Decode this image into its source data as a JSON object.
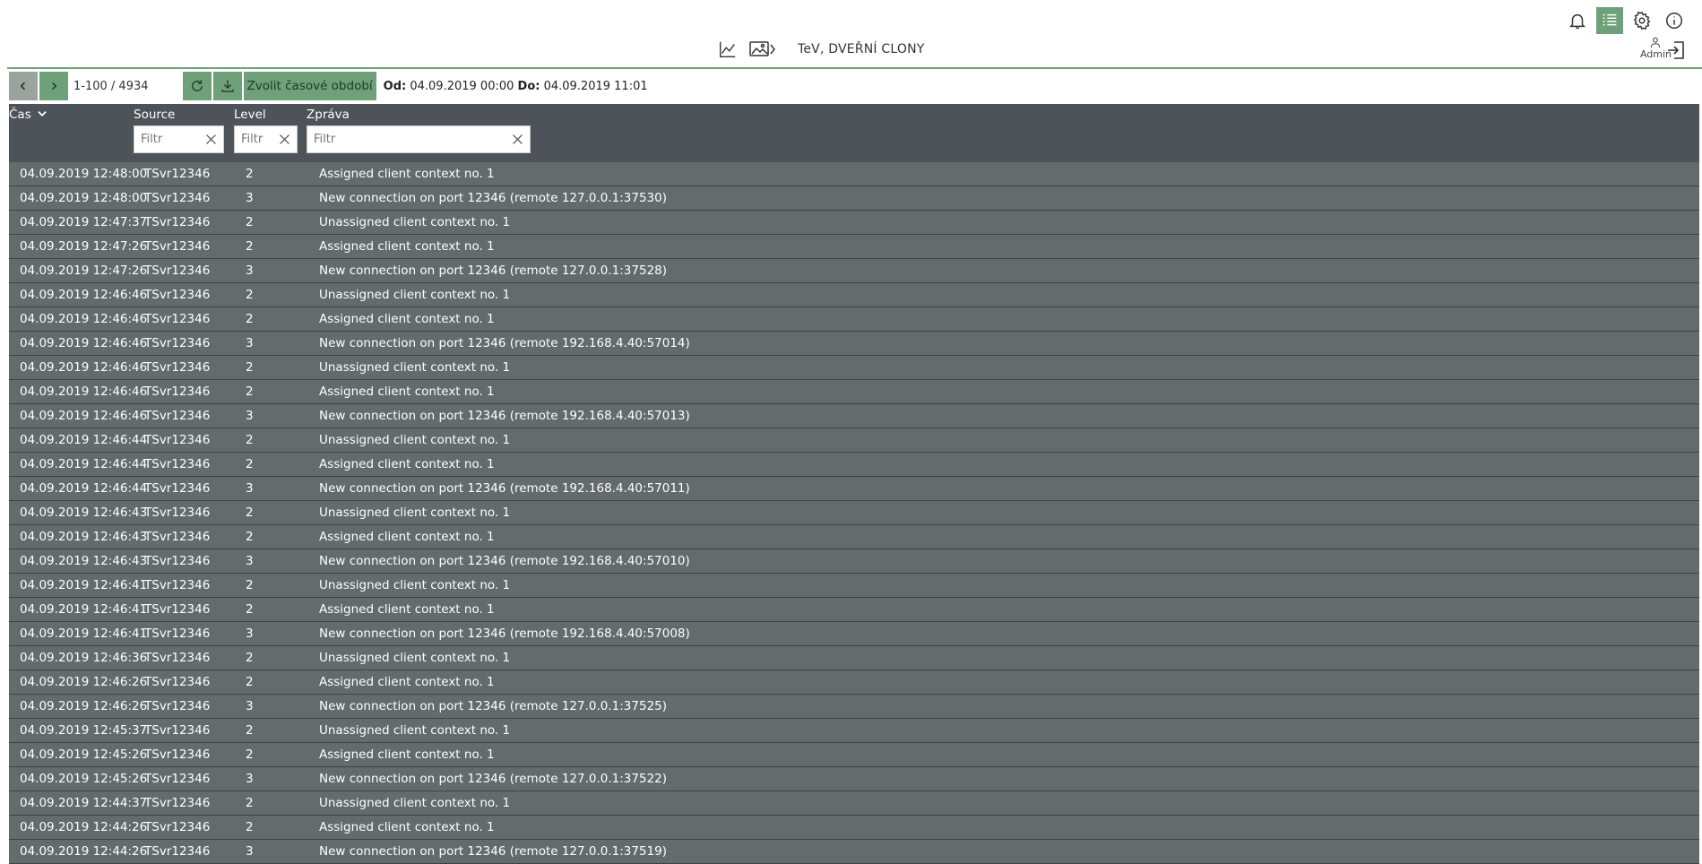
{
  "header": {
    "title": "TeV, DVEŘNÍ CLONY",
    "user": "Admin",
    "colors": {
      "accent": "#6ea07a",
      "table_header": "#4d5358",
      "row": "#636b6d"
    }
  },
  "toolbar": {
    "range": "1-100 / 4934",
    "choose_period_label": "Zvolit časové období",
    "from_label": "Od:",
    "from_value": "04.09.2019 00:00",
    "to_label": "Do:",
    "to_value": "04.09.2019 11:01"
  },
  "table": {
    "columns": {
      "time": "Čas",
      "source": "Source",
      "level": "Level",
      "message": "Zpráva"
    },
    "filter_placeholder": "Filtr",
    "rows": [
      {
        "time": "04.09.2019 12:48:00",
        "source": "TSvr12346",
        "level": "2",
        "message": "Assigned client context no. 1"
      },
      {
        "time": "04.09.2019 12:48:00",
        "source": "TSvr12346",
        "level": "3",
        "message": "New connection on port 12346 (remote 127.0.0.1:37530)"
      },
      {
        "time": "04.09.2019 12:47:37",
        "source": "TSvr12346",
        "level": "2",
        "message": "Unassigned client context no. 1"
      },
      {
        "time": "04.09.2019 12:47:26",
        "source": "TSvr12346",
        "level": "2",
        "message": "Assigned client context no. 1"
      },
      {
        "time": "04.09.2019 12:47:26",
        "source": "TSvr12346",
        "level": "3",
        "message": "New connection on port 12346 (remote 127.0.0.1:37528)"
      },
      {
        "time": "04.09.2019 12:46:46",
        "source": "TSvr12346",
        "level": "2",
        "message": "Unassigned client context no. 1"
      },
      {
        "time": "04.09.2019 12:46:46",
        "source": "TSvr12346",
        "level": "2",
        "message": "Assigned client context no. 1"
      },
      {
        "time": "04.09.2019 12:46:46",
        "source": "TSvr12346",
        "level": "3",
        "message": "New connection on port 12346 (remote 192.168.4.40:57014)"
      },
      {
        "time": "04.09.2019 12:46:46",
        "source": "TSvr12346",
        "level": "2",
        "message": "Unassigned client context no. 1"
      },
      {
        "time": "04.09.2019 12:46:46",
        "source": "TSvr12346",
        "level": "2",
        "message": "Assigned client context no. 1"
      },
      {
        "time": "04.09.2019 12:46:46",
        "source": "TSvr12346",
        "level": "3",
        "message": "New connection on port 12346 (remote 192.168.4.40:57013)"
      },
      {
        "time": "04.09.2019 12:46:44",
        "source": "TSvr12346",
        "level": "2",
        "message": "Unassigned client context no. 1"
      },
      {
        "time": "04.09.2019 12:46:44",
        "source": "TSvr12346",
        "level": "2",
        "message": "Assigned client context no. 1"
      },
      {
        "time": "04.09.2019 12:46:44",
        "source": "TSvr12346",
        "level": "3",
        "message": "New connection on port 12346 (remote 192.168.4.40:57011)"
      },
      {
        "time": "04.09.2019 12:46:43",
        "source": "TSvr12346",
        "level": "2",
        "message": "Unassigned client context no. 1"
      },
      {
        "time": "04.09.2019 12:46:43",
        "source": "TSvr12346",
        "level": "2",
        "message": "Assigned client context no. 1"
      },
      {
        "time": "04.09.2019 12:46:43",
        "source": "TSvr12346",
        "level": "3",
        "message": "New connection on port 12346 (remote 192.168.4.40:57010)"
      },
      {
        "time": "04.09.2019 12:46:41",
        "source": "TSvr12346",
        "level": "2",
        "message": "Unassigned client context no. 1"
      },
      {
        "time": "04.09.2019 12:46:41",
        "source": "TSvr12346",
        "level": "2",
        "message": "Assigned client context no. 1"
      },
      {
        "time": "04.09.2019 12:46:41",
        "source": "TSvr12346",
        "level": "3",
        "message": "New connection on port 12346 (remote 192.168.4.40:57008)"
      },
      {
        "time": "04.09.2019 12:46:36",
        "source": "TSvr12346",
        "level": "2",
        "message": "Unassigned client context no. 1"
      },
      {
        "time": "04.09.2019 12:46:26",
        "source": "TSvr12346",
        "level": "2",
        "message": "Assigned client context no. 1"
      },
      {
        "time": "04.09.2019 12:46:26",
        "source": "TSvr12346",
        "level": "3",
        "message": "New connection on port 12346 (remote 127.0.0.1:37525)"
      },
      {
        "time": "04.09.2019 12:45:37",
        "source": "TSvr12346",
        "level": "2",
        "message": "Unassigned client context no. 1"
      },
      {
        "time": "04.09.2019 12:45:26",
        "source": "TSvr12346",
        "level": "2",
        "message": "Assigned client context no. 1"
      },
      {
        "time": "04.09.2019 12:45:26",
        "source": "TSvr12346",
        "level": "3",
        "message": "New connection on port 12346 (remote 127.0.0.1:37522)"
      },
      {
        "time": "04.09.2019 12:44:37",
        "source": "TSvr12346",
        "level": "2",
        "message": "Unassigned client context no. 1"
      },
      {
        "time": "04.09.2019 12:44:26",
        "source": "TSvr12346",
        "level": "2",
        "message": "Assigned client context no. 1"
      },
      {
        "time": "04.09.2019 12:44:26",
        "source": "TSvr12346",
        "level": "3",
        "message": "New connection on port 12346 (remote 127.0.0.1:37519)"
      }
    ]
  }
}
